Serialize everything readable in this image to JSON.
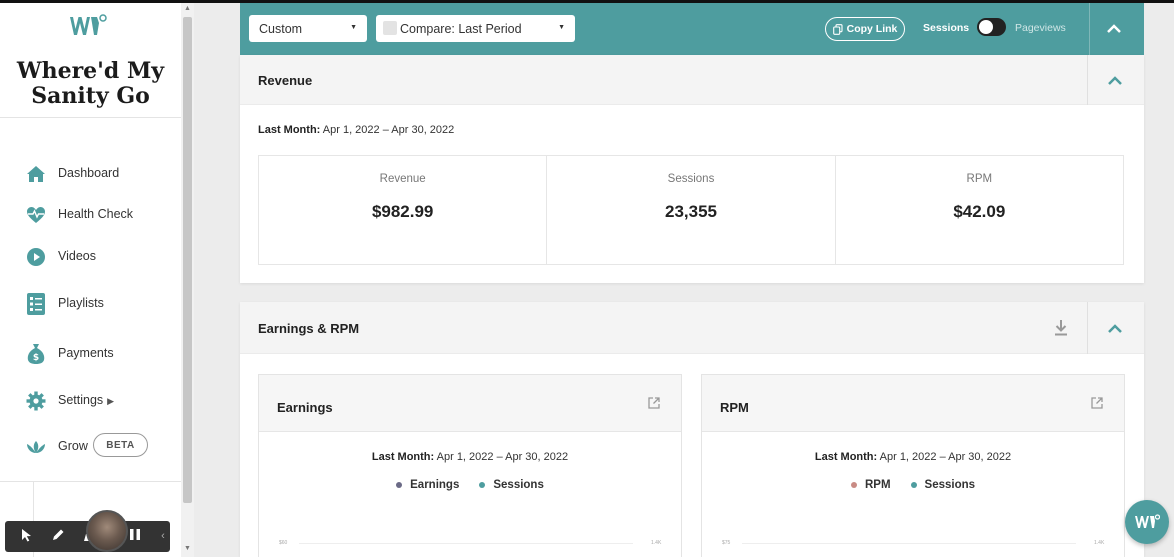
{
  "sidebar": {
    "title": "Where'd My Sanity Go",
    "items": [
      {
        "label": "Dashboard",
        "icon": "home-icon"
      },
      {
        "label": "Health Check",
        "icon": "heartbeat-icon"
      },
      {
        "label": "Videos",
        "icon": "play-circle-icon"
      },
      {
        "label": "Playlists",
        "icon": "list-icon"
      },
      {
        "label": "Payments",
        "icon": "money-bag-icon"
      },
      {
        "label": "Settings",
        "icon": "gear-icon"
      },
      {
        "label": "Grow",
        "icon": "lotus-icon",
        "badge": "BETA"
      }
    ]
  },
  "filters": {
    "range_value": "Custom",
    "compare_value": "Compare: Last Period",
    "copy_link_label": "Copy Link",
    "sessions_label": "Sessions",
    "pageviews_label": "Pageviews"
  },
  "revenue": {
    "title": "Revenue",
    "range_label": "Last Month:",
    "range_value": "Apr 1, 2022 – Apr 30, 2022",
    "metrics": [
      {
        "label": "Revenue",
        "value": "$982.99"
      },
      {
        "label": "Sessions",
        "value": "23,355"
      },
      {
        "label": "RPM",
        "value": "$42.09"
      }
    ]
  },
  "earnings_rpm": {
    "title": "Earnings & RPM",
    "earnings": {
      "title": "Earnings",
      "range_label": "Last Month:",
      "range_value": "Apr 1, 2022 – Apr 30, 2022",
      "legend": [
        {
          "label": "Earnings",
          "color": "#6b6a86"
        },
        {
          "label": "Sessions",
          "color": "#4e9d9f"
        }
      ],
      "tick_left": "$60",
      "tick_right": "1.4K"
    },
    "rpm": {
      "title": "RPM",
      "range_label": "Last Month:",
      "range_value": "Apr 1, 2022 – Apr 30, 2022",
      "legend": [
        {
          "label": "RPM",
          "color": "#c98b84"
        },
        {
          "label": "Sessions",
          "color": "#4e9d9f"
        }
      ],
      "tick_left": "$75",
      "tick_right": "1.4K"
    }
  },
  "colors": {
    "brand": "#4e9d9f",
    "text": "#222222"
  }
}
